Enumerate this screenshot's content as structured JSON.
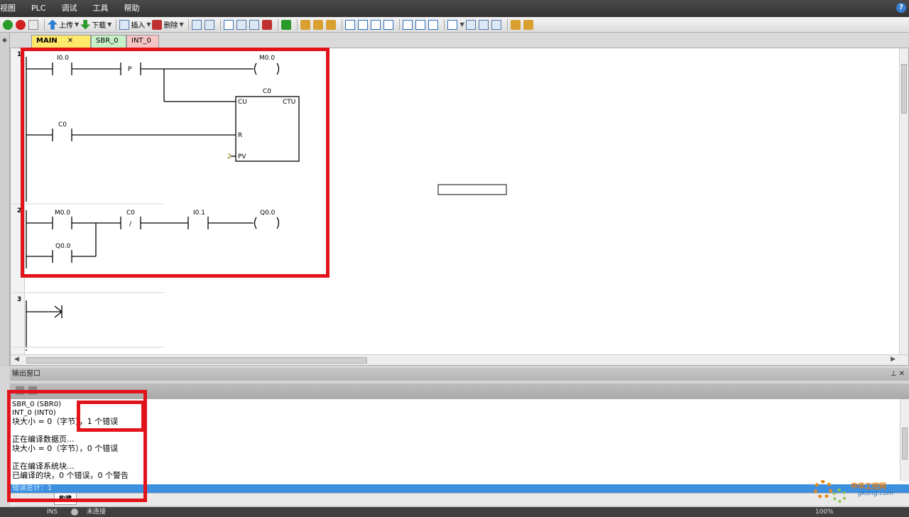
{
  "menu": [
    "视图",
    "PLC",
    "调试",
    "工具",
    "帮助"
  ],
  "toolbar": {
    "upload": "上传",
    "download": "下载",
    "insert": "插入",
    "delete": "删除"
  },
  "tabs": [
    {
      "label": "MAIN",
      "close": "✕"
    },
    {
      "label": "SBR_0"
    },
    {
      "label": "INT_0"
    }
  ],
  "networks": [
    {
      "number": "1",
      "labels": {
        "contact1": "I0.0",
        "p_contact": "P",
        "coil": "M0.0",
        "counter": "C0",
        "cu": "CU",
        "ctu": "CTU",
        "contact2": "C0",
        "r": "R",
        "pv_value": "2",
        "pv": "PV"
      }
    },
    {
      "number": "2",
      "labels": {
        "contact1": "M0.0",
        "contact2": "C0",
        "nc": "/",
        "contact3": "I0.1",
        "coil": "Q0.0",
        "contact4": "Q0.0"
      }
    },
    {
      "number": "3"
    }
  ],
  "output": {
    "title": "输出窗口",
    "lines": [
      "SBR_0 (SBR0)",
      "INT_0 (INT0)",
      "块大小 = 0（字节），1 个错误",
      "",
      "正在编译数据页...",
      "块大小 = 0（字节），0 个错误",
      "",
      "正在编译系统块...",
      "已编译的块，0 个错误，0 个警告"
    ],
    "error_total": "错误总计：1",
    "tab_label": "构建"
  },
  "status": {
    "ins": "INS",
    "connection": "未连接",
    "zoom": "100%"
  },
  "watermark": {
    "text": "中华工控网",
    "sub": "gkong.com"
  }
}
